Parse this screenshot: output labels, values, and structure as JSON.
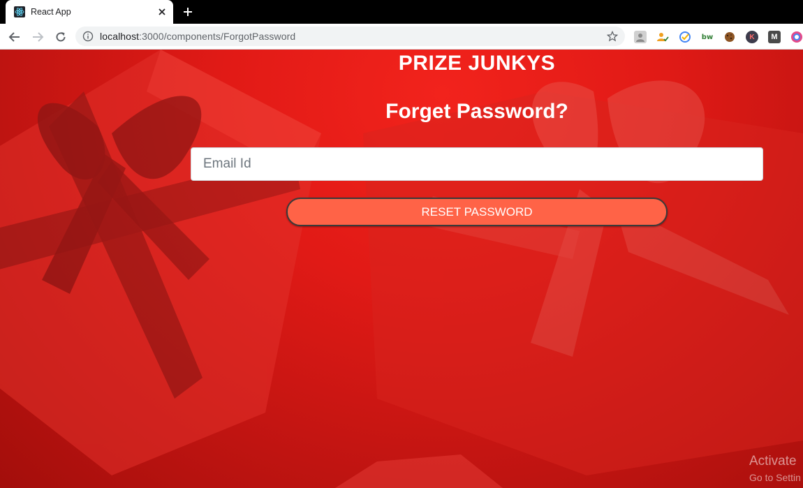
{
  "browser": {
    "tab_title": "React App",
    "url_host": "localhost",
    "url_path": ":3000/components/ForgotPassword",
    "extensions": [
      {
        "icon": "profile-extension-icon",
        "label": "",
        "color": "#c8c8c8"
      },
      {
        "icon": "person-check-extension-icon",
        "label": "",
        "color": "#f0a020"
      },
      {
        "icon": "checkmark-circle-extension-icon",
        "label": "",
        "color": "#4285f4"
      },
      {
        "icon": "bw-extension-icon",
        "label": "bw",
        "color": "#2e7d32"
      },
      {
        "icon": "cookie-extension-icon",
        "label": "",
        "color": "#8d5524"
      },
      {
        "icon": "k-extension-icon",
        "label": "K",
        "color": "#3c3c4c"
      },
      {
        "icon": "m-extension-icon",
        "label": "M",
        "color": "#4a4a4a"
      },
      {
        "icon": "chrome-color-extension-icon",
        "label": "",
        "color": "#e34a8a"
      }
    ]
  },
  "page": {
    "brand": "PRIZE JUNKYS",
    "heading": "Forget Password?",
    "email_placeholder": "Email Id",
    "email_value": "",
    "reset_button_label": "RESET PASSWORD"
  },
  "watermark": {
    "title": "Activate",
    "subtitle": "Go to Settin"
  },
  "colors": {
    "background_red": "#e11a16",
    "button_tomato": "#ff6347",
    "text_white": "#ffffff"
  }
}
